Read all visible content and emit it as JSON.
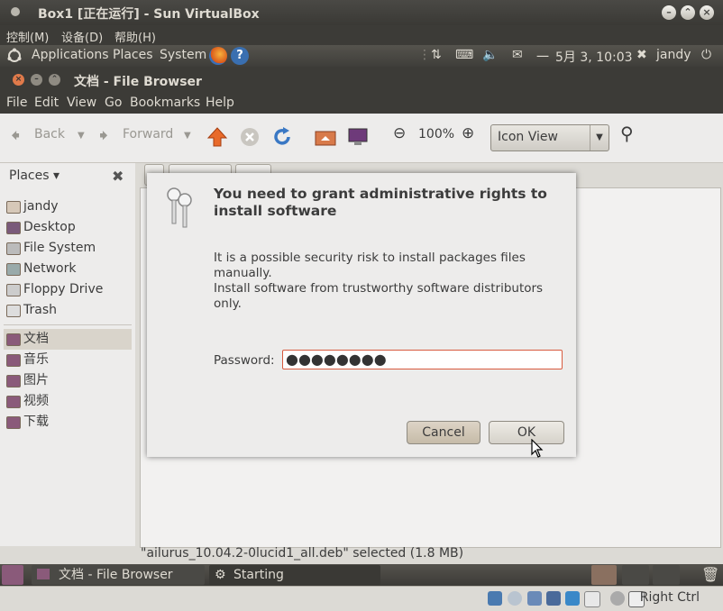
{
  "vbox": {
    "title": "Box1 [正在运行] - Sun VirtualBox",
    "menu": [
      "控制(M)",
      "设备(D)",
      "帮助(H)"
    ],
    "status_right": "Right Ctrl"
  },
  "top_panel": {
    "applications": "Applications",
    "places": "Places",
    "system": "System",
    "clock": "5月  3, 10:03",
    "user": "jandy",
    "separator": "一"
  },
  "file_browser": {
    "title": "文档 - File Browser",
    "menu": [
      "File",
      "Edit",
      "View",
      "Go",
      "Bookmarks",
      "Help"
    ],
    "toolbar": {
      "back": "Back",
      "forward": "Forward",
      "zoom": "100%",
      "view_mode": "Icon View"
    },
    "sidebar": {
      "header": "Places",
      "items": [
        "jandy",
        "Desktop",
        "File System",
        "Network",
        "Floppy Drive",
        "Trash"
      ],
      "bookmarks": [
        "文档",
        "音乐",
        "图片",
        "视频",
        "下载"
      ],
      "selected": "文档"
    },
    "status": "\"ailurus_10.04.2-0lucid1_all.deb\" selected (1.8 MB)"
  },
  "dialog": {
    "title": "You need to grant administrative rights to install software",
    "message_line1": "It is a possible security risk to install packages files manually.",
    "message_line2": "Install software from trustworthy software distributors only.",
    "password_label": "Password:",
    "password_value": "●●●●●●●●",
    "cancel": "Cancel",
    "ok": "OK"
  },
  "bottom_panel": {
    "task1": "文档 - File Browser",
    "task2": "Starting Administrativ..."
  }
}
